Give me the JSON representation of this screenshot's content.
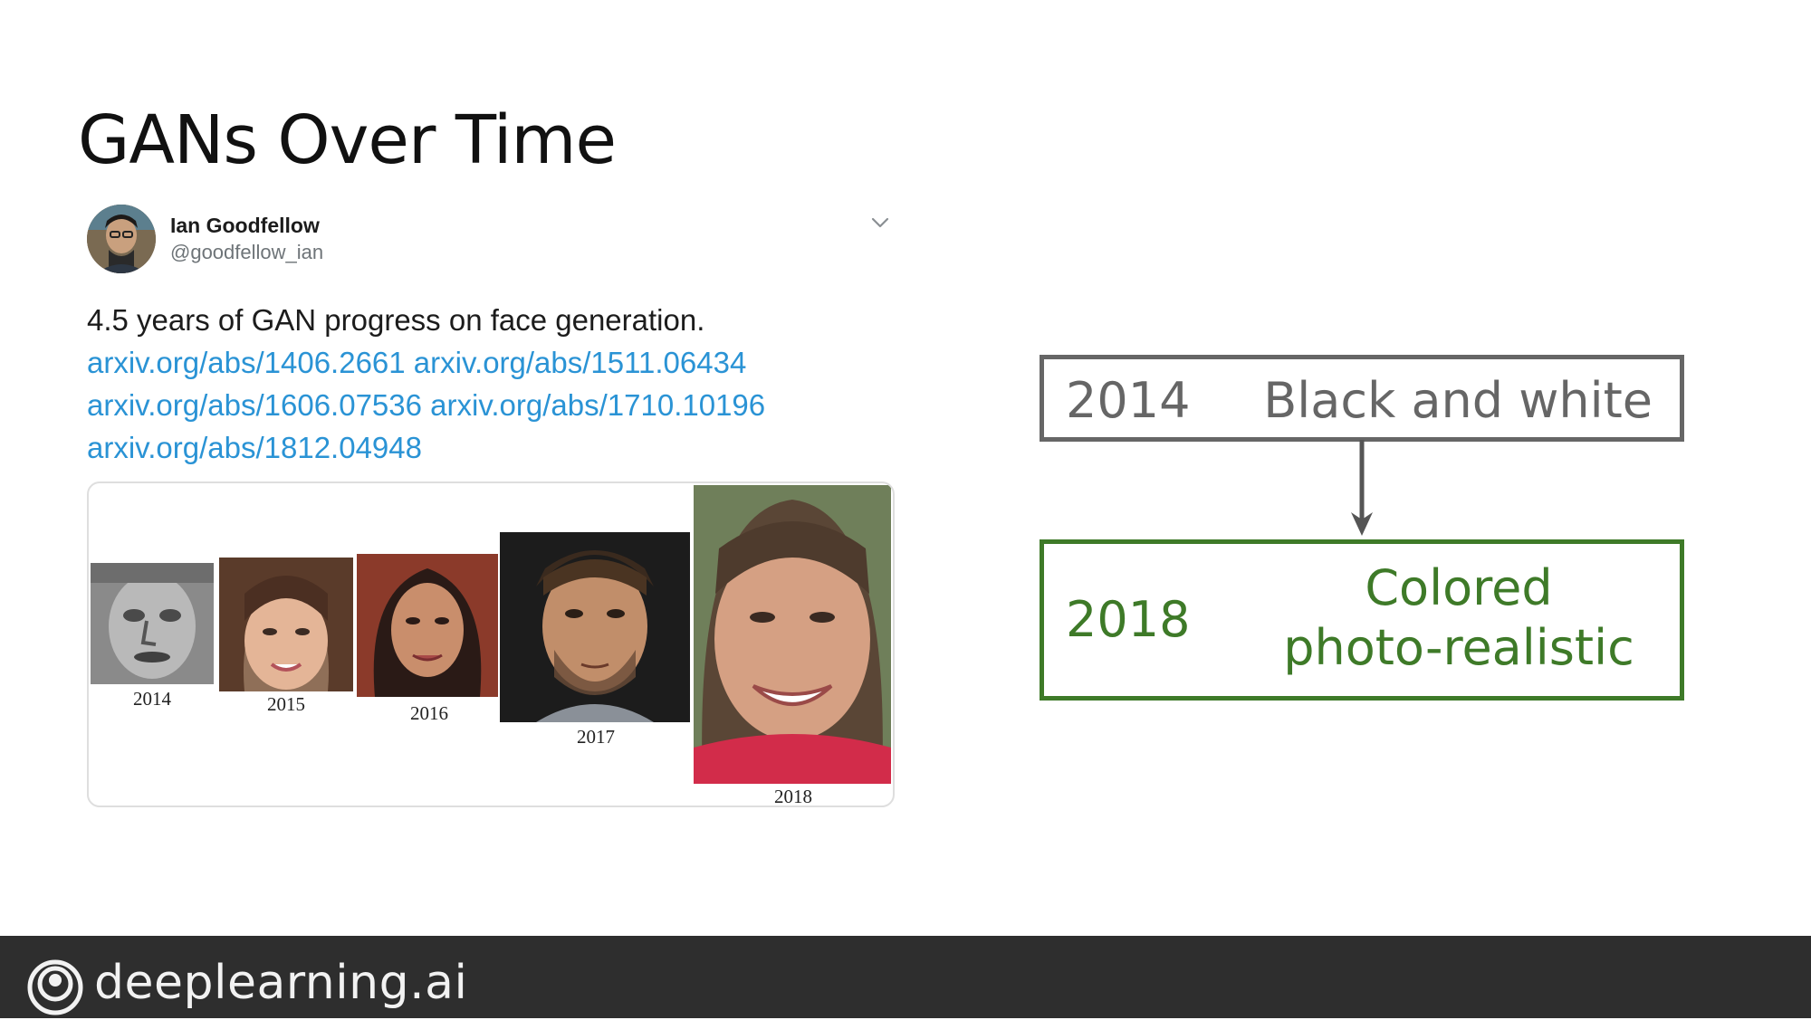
{
  "slide": {
    "title": "GANs Over Time"
  },
  "tweet": {
    "author_name": "Ian Goodfellow",
    "author_handle": "@goodfellow_ian",
    "text": "4.5 years of GAN progress on face generation.",
    "links": [
      "arxiv.org/abs/1406.2661",
      "arxiv.org/abs/1511.06434",
      "arxiv.org/abs/1606.07536",
      "arxiv.org/abs/1710.10196",
      "arxiv.org/abs/1812.04948"
    ],
    "menu_icon": "chevron-down-icon",
    "media": {
      "faces": [
        {
          "year": "2014"
        },
        {
          "year": "2015"
        },
        {
          "year": "2016"
        },
        {
          "year": "2017"
        },
        {
          "year": "2018"
        }
      ]
    }
  },
  "flow": {
    "from": {
      "year": "2014",
      "description": "Black and white"
    },
    "to": {
      "year": "2018",
      "description_line1": "Colored",
      "description_line2": "photo-realistic"
    },
    "colors": {
      "from": "#666666",
      "to": "#3e7a28"
    }
  },
  "footer": {
    "brand": "deeplearning.ai",
    "logo_icon": "deeplearning-logo-icon"
  }
}
